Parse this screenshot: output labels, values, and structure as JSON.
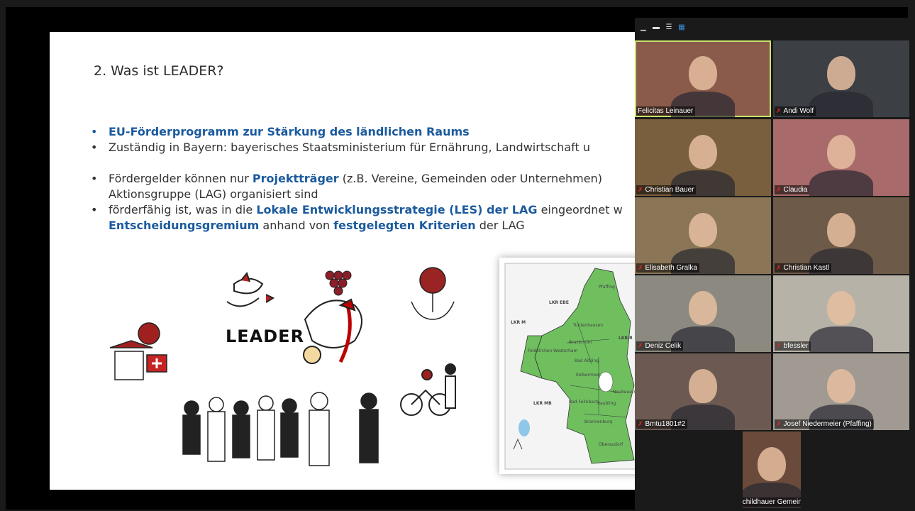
{
  "slide": {
    "title": "2. Was ist LEADER?",
    "bullets": [
      {
        "segments": [
          {
            "text": "EU-Förderprogramm zur Stärkung des ländlichen Raums",
            "bold": true
          }
        ],
        "blue_dot": true
      },
      {
        "segments": [
          {
            "text": "Zuständig in Bayern: bayerisches Staatsministerium für Ernährung, Landwirtschaft u",
            "bold": false
          }
        ],
        "blue_dot": false
      },
      {
        "gap": true
      },
      {
        "segments": [
          {
            "text": "Fördergelder können nur ",
            "bold": false
          },
          {
            "text": "Projektträger",
            "bold": true
          },
          {
            "text": " (z.B. Vereine, Gemeinden oder Unternehmen) ",
            "bold": false
          }
        ],
        "blue_dot": false
      },
      {
        "segments": [
          {
            "text": "Aktionsgruppe (LAG) organisiert sind",
            "bold": false
          }
        ],
        "continuation": true
      },
      {
        "segments": [
          {
            "text": "förderfähig ist, was in die ",
            "bold": false
          },
          {
            "text": "Lokale Entwicklungsstrategie (LES) der LAG",
            "bold": true
          },
          {
            "text": " eingeordnet w",
            "bold": false
          }
        ],
        "blue_dot": false
      },
      {
        "segments": [
          {
            "text": "Entscheidungsgremium",
            "bold": true
          },
          {
            "text": " anhand von ",
            "bold": false
          },
          {
            "text": "festgelegten Kriterien",
            "bold": true
          },
          {
            "text": " der LAG",
            "bold": false
          }
        ],
        "continuation": true
      }
    ],
    "illustration_word": "LEADER",
    "map_labels": [
      "LKR EBE",
      "LKR M",
      "LKR R",
      "LKR MB",
      "Pfaffing",
      "Tuntenhausen",
      "Bruckmühl",
      "Bad Aibling",
      "Kolbermoor",
      "Bad Feilnbach",
      "Raubling",
      "Brannenburg",
      "Oberaudorf",
      "Neubeuern",
      "Feldkirchen-Westerham"
    ]
  },
  "gallery": {
    "view_controls": [
      "minimize-icon",
      "speaker-view-icon",
      "strip-view-icon",
      "grid-view-icon"
    ],
    "participants": [
      {
        "name": "Felicitas Leinauer",
        "muted": false,
        "active": true,
        "color": "#8a5a4a"
      },
      {
        "name": "Andi Wolf",
        "muted": true,
        "active": false,
        "color": "#3c3f44"
      },
      {
        "name": "Christian Bauer",
        "muted": true,
        "active": false,
        "color": "#7a5f3e"
      },
      {
        "name": "Claudia",
        "muted": true,
        "active": false,
        "color": "#a86a6a"
      },
      {
        "name": "Elisabeth Gralka",
        "muted": true,
        "active": false,
        "color": "#8a7556"
      },
      {
        "name": "Christian Kastl",
        "muted": true,
        "active": false,
        "color": "#6e5a48"
      },
      {
        "name": "Deniz Celik",
        "muted": true,
        "active": false,
        "color": "#8c8a80"
      },
      {
        "name": "bfessler",
        "muted": true,
        "active": false,
        "color": "#b7b2a8"
      },
      {
        "name": "Bmtu1801#2",
        "muted": true,
        "active": false,
        "color": "#6c5a52"
      },
      {
        "name": "Josef Niedermeier (Pfaffing)",
        "muted": true,
        "active": false,
        "color": "#a09a92"
      },
      {
        "name": "Georg Schildhauer Gemeinde Sche...",
        "muted": true,
        "active": false,
        "color": "#6a4a3a"
      }
    ]
  },
  "colors": {
    "accent_blue": "#1b5a9e",
    "map_green": "#6fbf5f",
    "active_border": "#c8e26a",
    "muted_mic": "#e02828"
  }
}
